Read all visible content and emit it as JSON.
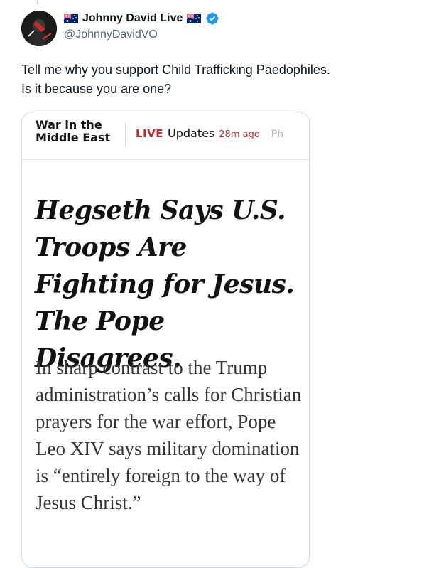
{
  "author": {
    "display_name": "Johnny David Live",
    "handle": "@JohnnyDavidVO",
    "flag_icon": "australia-flag-icon",
    "verified_icon": "verified-badge-icon",
    "verified_color": "#1d9bf0"
  },
  "tweet": {
    "text_line1": "Tell me why you support Child Trafficking Paedophiles.",
    "text_line2": "Is it because you are one?"
  },
  "media": {
    "section_title": "War in the Middle East",
    "live_label": "LIVE",
    "updates_label": "Updates",
    "time_ago": "28m ago",
    "clipped_text": "Ph",
    "headline": "Hegseth Says U.S. Troops Are Fighting for Jesus. The Pope Disagrees.",
    "summary": "In sharp contrast to the Trump administration’s calls for Christian prayers for the war effort, Pope Leo XIV says military domination is “entirely foreign to the way of Jesus Christ.”",
    "live_color": "#c1272d"
  }
}
